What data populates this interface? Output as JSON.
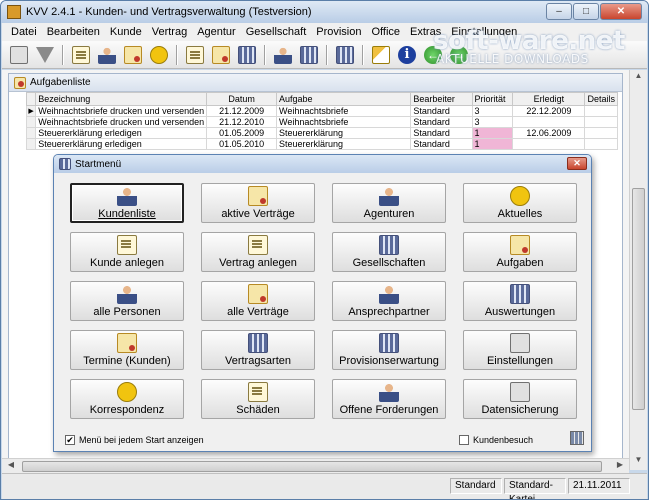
{
  "window": {
    "title": "KVV 2.4.1  -  Kunden- und Vertragsverwaltung (Testversion)",
    "buttons": {
      "minimize": "–",
      "maximize": "□",
      "close": "✕"
    }
  },
  "menubar": {
    "items": [
      "Datei",
      "Bearbeiten",
      "Kunde",
      "Vertrag",
      "Agentur",
      "Gesellschaft",
      "Provision",
      "Office",
      "Extras",
      "Einstellungen"
    ]
  },
  "watermark": {
    "brand": "soft-ware.net",
    "subtitle": "AKTUELLE DOWNLOADS"
  },
  "tasklist": {
    "title": "Aufgabenliste",
    "columns": [
      "Bezeichnung",
      "Datum",
      "Aufgabe",
      "Bearbeiter",
      "Priorität",
      "Erledigt",
      "Details"
    ],
    "rows": [
      {
        "marker": "▶",
        "bezeichnung": "Weihnachtsbriefe drucken und versenden",
        "datum": "21.12.2009",
        "aufgabe": "Weihnachtsbriefe",
        "bearbeiter": "Standard",
        "prioritaet": "3",
        "erledigt": "22.12.2009",
        "details": ""
      },
      {
        "marker": "",
        "bezeichnung": "Weihnachtsbriefe drucken und versenden",
        "datum": "21.12.2010",
        "aufgabe": "Weihnachtsbriefe",
        "bearbeiter": "Standard",
        "prioritaet": "3",
        "erledigt": "",
        "details": ""
      },
      {
        "marker": "",
        "bezeichnung": "Steuererklärung erledigen",
        "datum": "01.05.2009",
        "aufgabe": "Steuererklärung",
        "bearbeiter": "Standard",
        "prioritaet": "1",
        "erledigt": "12.06.2009",
        "details": ""
      },
      {
        "marker": "",
        "bezeichnung": "Steuererklärung erledigen",
        "datum": "01.05.2010",
        "aufgabe": "Steuererklärung",
        "bearbeiter": "Standard",
        "prioritaet": "1",
        "erledigt": "",
        "details": ""
      }
    ]
  },
  "startmenu": {
    "title": "Startmenü",
    "close": "✕",
    "buttons": [
      [
        "Kundenliste",
        "aktive Verträge",
        "Agenturen",
        "Aktuelles"
      ],
      [
        "Kunde anlegen",
        "Vertrag anlegen",
        "Gesellschaften",
        "Aufgaben"
      ],
      [
        "alle Personen",
        "alle Verträge",
        "Ansprechpartner",
        "Auswertungen"
      ],
      [
        "Termine (Kunden)",
        "Vertragsarten",
        "Provisionserwartung",
        "Einstellungen"
      ],
      [
        "Korrespondenz",
        "Schäden",
        "Offene Forderungen",
        "Datensicherung"
      ]
    ],
    "show_on_start_label": "Menü bei jedem Start anzeigen",
    "show_on_start_checked": "✔",
    "kundenbesuch_label": "Kundenbesuch"
  },
  "statusbar": {
    "user": "Standard",
    "kartei": "Standard-Kartei",
    "date": "21.11.2011"
  }
}
